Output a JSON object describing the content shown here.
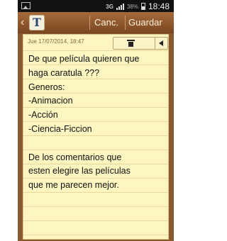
{
  "status_bar": {
    "left_icon": "image-icon",
    "network_label": "3G",
    "battery_percent": "38%",
    "time": "18:48"
  },
  "action_bar": {
    "back_icon": "back-chevron-icon",
    "app_icon": "T",
    "cancel_label": "Canc.",
    "save_label": "Guardar"
  },
  "note": {
    "date": "Jue 17/07/2014, 18:47",
    "toolbar": {
      "delete_icon": "trash-icon",
      "collapse_icon": "triangle-left-icon"
    },
    "lines": [
      "De que película quieren que",
      "haga caratula ???",
      "Generos:",
      "-Animacion",
      "-Acción",
      "-Ciencia-Ficcion",
      "",
      "De los comentarios que",
      "esten elegire las películas",
      "que me parecen mejor."
    ]
  },
  "colors": {
    "paper": "#fdf6c0",
    "paper_lines": "#e9d89a",
    "action_bar": "#7a4722",
    "text": "#111111"
  }
}
